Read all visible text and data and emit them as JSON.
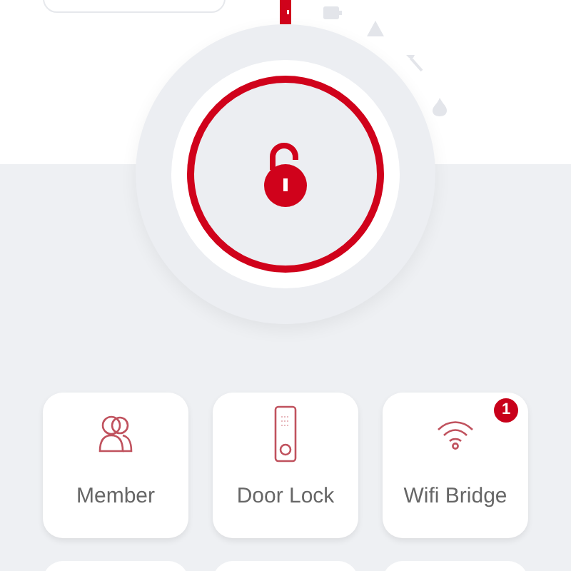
{
  "lock": {
    "locked": false
  },
  "status_icons": [
    {
      "kind": "door",
      "active": true
    },
    {
      "kind": "battery",
      "active": false
    },
    {
      "kind": "warning",
      "active": false
    },
    {
      "kind": "hammer",
      "active": false
    },
    {
      "kind": "flame",
      "active": false
    }
  ],
  "tiles": [
    {
      "kind": "member",
      "label": "Member"
    },
    {
      "kind": "doorlock",
      "label": "Door Lock"
    },
    {
      "kind": "wifi",
      "label": "Wifi Bridge",
      "badge": "1"
    }
  ]
}
